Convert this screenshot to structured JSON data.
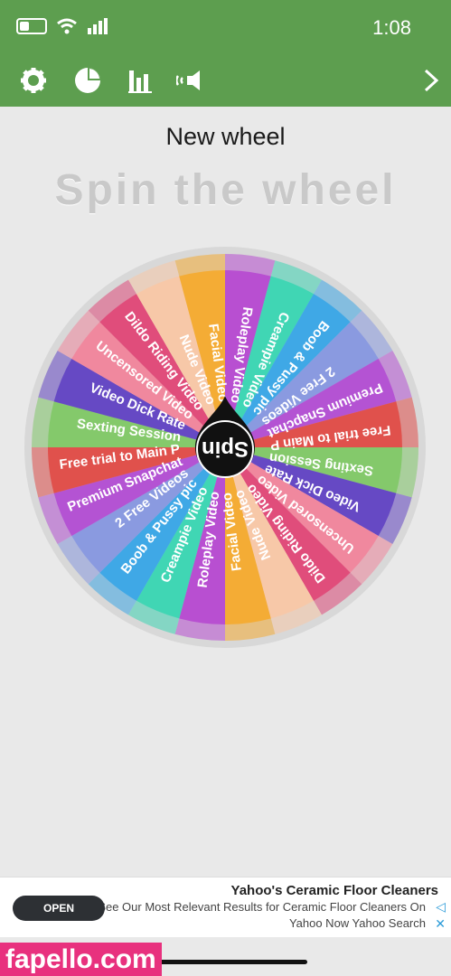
{
  "status_bar": {
    "time": "1:08"
  },
  "toolbar": {
    "icons": [
      "gear-icon",
      "pie-chart-icon",
      "bar-chart-icon",
      "sound-icon",
      "chevron-right-icon"
    ]
  },
  "titles": {
    "wheel_name": "New wheel",
    "spin_title": "Spin the wheel"
  },
  "wheel": {
    "center_label": "Spin",
    "segments": [
      {
        "label": "Roleplay Video",
        "color": "#b84fd1"
      },
      {
        "label": "Creampie Video",
        "color": "#40d6b4"
      },
      {
        "label": "Boob & Pussy pic",
        "color": "#3fa8e6"
      },
      {
        "label": "2 Free Videos",
        "color": "#8a9ae0"
      },
      {
        "label": "Premium Snapchat",
        "color": "#b453d3"
      },
      {
        "label": "Free trial to Main P",
        "color": "#e0514c"
      },
      {
        "label": "Sexting Session",
        "color": "#84c96b"
      },
      {
        "label": "Video Dick Rate",
        "color": "#6649c4"
      },
      {
        "label": "Uncensored Video",
        "color": "#f0889e"
      },
      {
        "label": "Dildo Riding Video",
        "color": "#e04d7b"
      },
      {
        "label": "Nude Video",
        "color": "#f7c8a8"
      },
      {
        "label": "Facial Video",
        "color": "#f4ac35"
      },
      {
        "label": "Roleplay Video",
        "color": "#b84fd1"
      },
      {
        "label": "Creampie Video",
        "color": "#40d6b4"
      },
      {
        "label": "Boob & Pussy pic",
        "color": "#3fa8e6"
      },
      {
        "label": "2 Free Videos",
        "color": "#8a9ae0"
      },
      {
        "label": "Premium Snapchat",
        "color": "#b453d3"
      },
      {
        "label": "Free trial to Main P",
        "color": "#e0514c"
      },
      {
        "label": "Sexting Session",
        "color": "#84c96b"
      },
      {
        "label": "Video Dick Rate",
        "color": "#6649c4"
      },
      {
        "label": "Uncensored Video",
        "color": "#f0889e"
      },
      {
        "label": "Dildo Riding Video",
        "color": "#e04d7b"
      },
      {
        "label": "Nude Video",
        "color": "#f7c8a8"
      },
      {
        "label": "Facial Video",
        "color": "#f4ac35"
      }
    ]
  },
  "ad": {
    "title": "Yahoo's Ceramic Floor Cleaners",
    "description": "See Our Most Relevant Results for Ceramic Floor Cleaners On",
    "source": "Yahoo Now Yahoo Search",
    "button": "OPEN"
  },
  "watermark": "fapello.com"
}
